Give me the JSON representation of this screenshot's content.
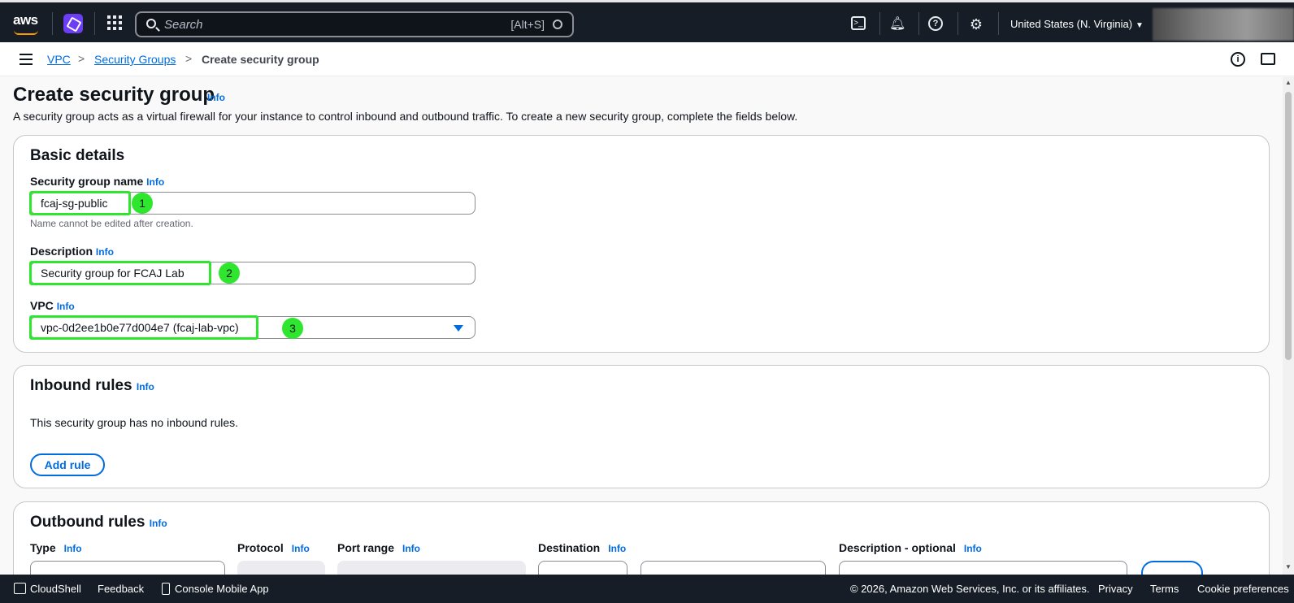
{
  "topnav": {
    "logo": "aws",
    "search_placeholder": "Search",
    "search_shortcut": "[Alt+S]",
    "region": "United States (N. Virginia)",
    "icons": [
      "cloudshell-icon",
      "bell-icon",
      "help-icon",
      "gear-icon"
    ]
  },
  "breadcrumb": {
    "items": [
      "VPC",
      "Security Groups",
      "Create security group"
    ]
  },
  "page": {
    "title": "Create security group",
    "info": "Info",
    "description": "A security group acts as a virtual firewall for your instance to control inbound and outbound traffic. To create a new security group, complete the fields below."
  },
  "basic_details": {
    "heading": "Basic details",
    "name_label": "Security group name",
    "name_value": "fcaj-sg-public",
    "name_hint": "Name cannot be edited after creation.",
    "desc_label": "Description",
    "desc_value": "Security group for FCAJ Lab",
    "vpc_label": "VPC",
    "vpc_value": "vpc-0d2ee1b0e77d004e7 (fcaj-lab-vpc)",
    "info": "Info",
    "annotations": [
      "1",
      "2",
      "3"
    ],
    "highlight_color": "#2ee62e"
  },
  "inbound": {
    "heading": "Inbound rules",
    "info": "Info",
    "empty_text": "This security group has no inbound rules.",
    "add_rule": "Add rule"
  },
  "outbound": {
    "heading": "Outbound rules",
    "info": "Info",
    "columns": [
      "Type",
      "Protocol",
      "Port range",
      "Destination",
      "Description - optional"
    ]
  },
  "footer": {
    "cloudshell": "CloudShell",
    "feedback": "Feedback",
    "mobile_app": "Console Mobile App",
    "copyright": "© 2026, Amazon Web Services, Inc. or its affiliates.",
    "privacy": "Privacy",
    "terms": "Terms",
    "cookies": "Cookie preferences"
  },
  "colors": {
    "nav_bg": "#161d26",
    "link": "#006ce0",
    "accent": "#ff9900"
  }
}
